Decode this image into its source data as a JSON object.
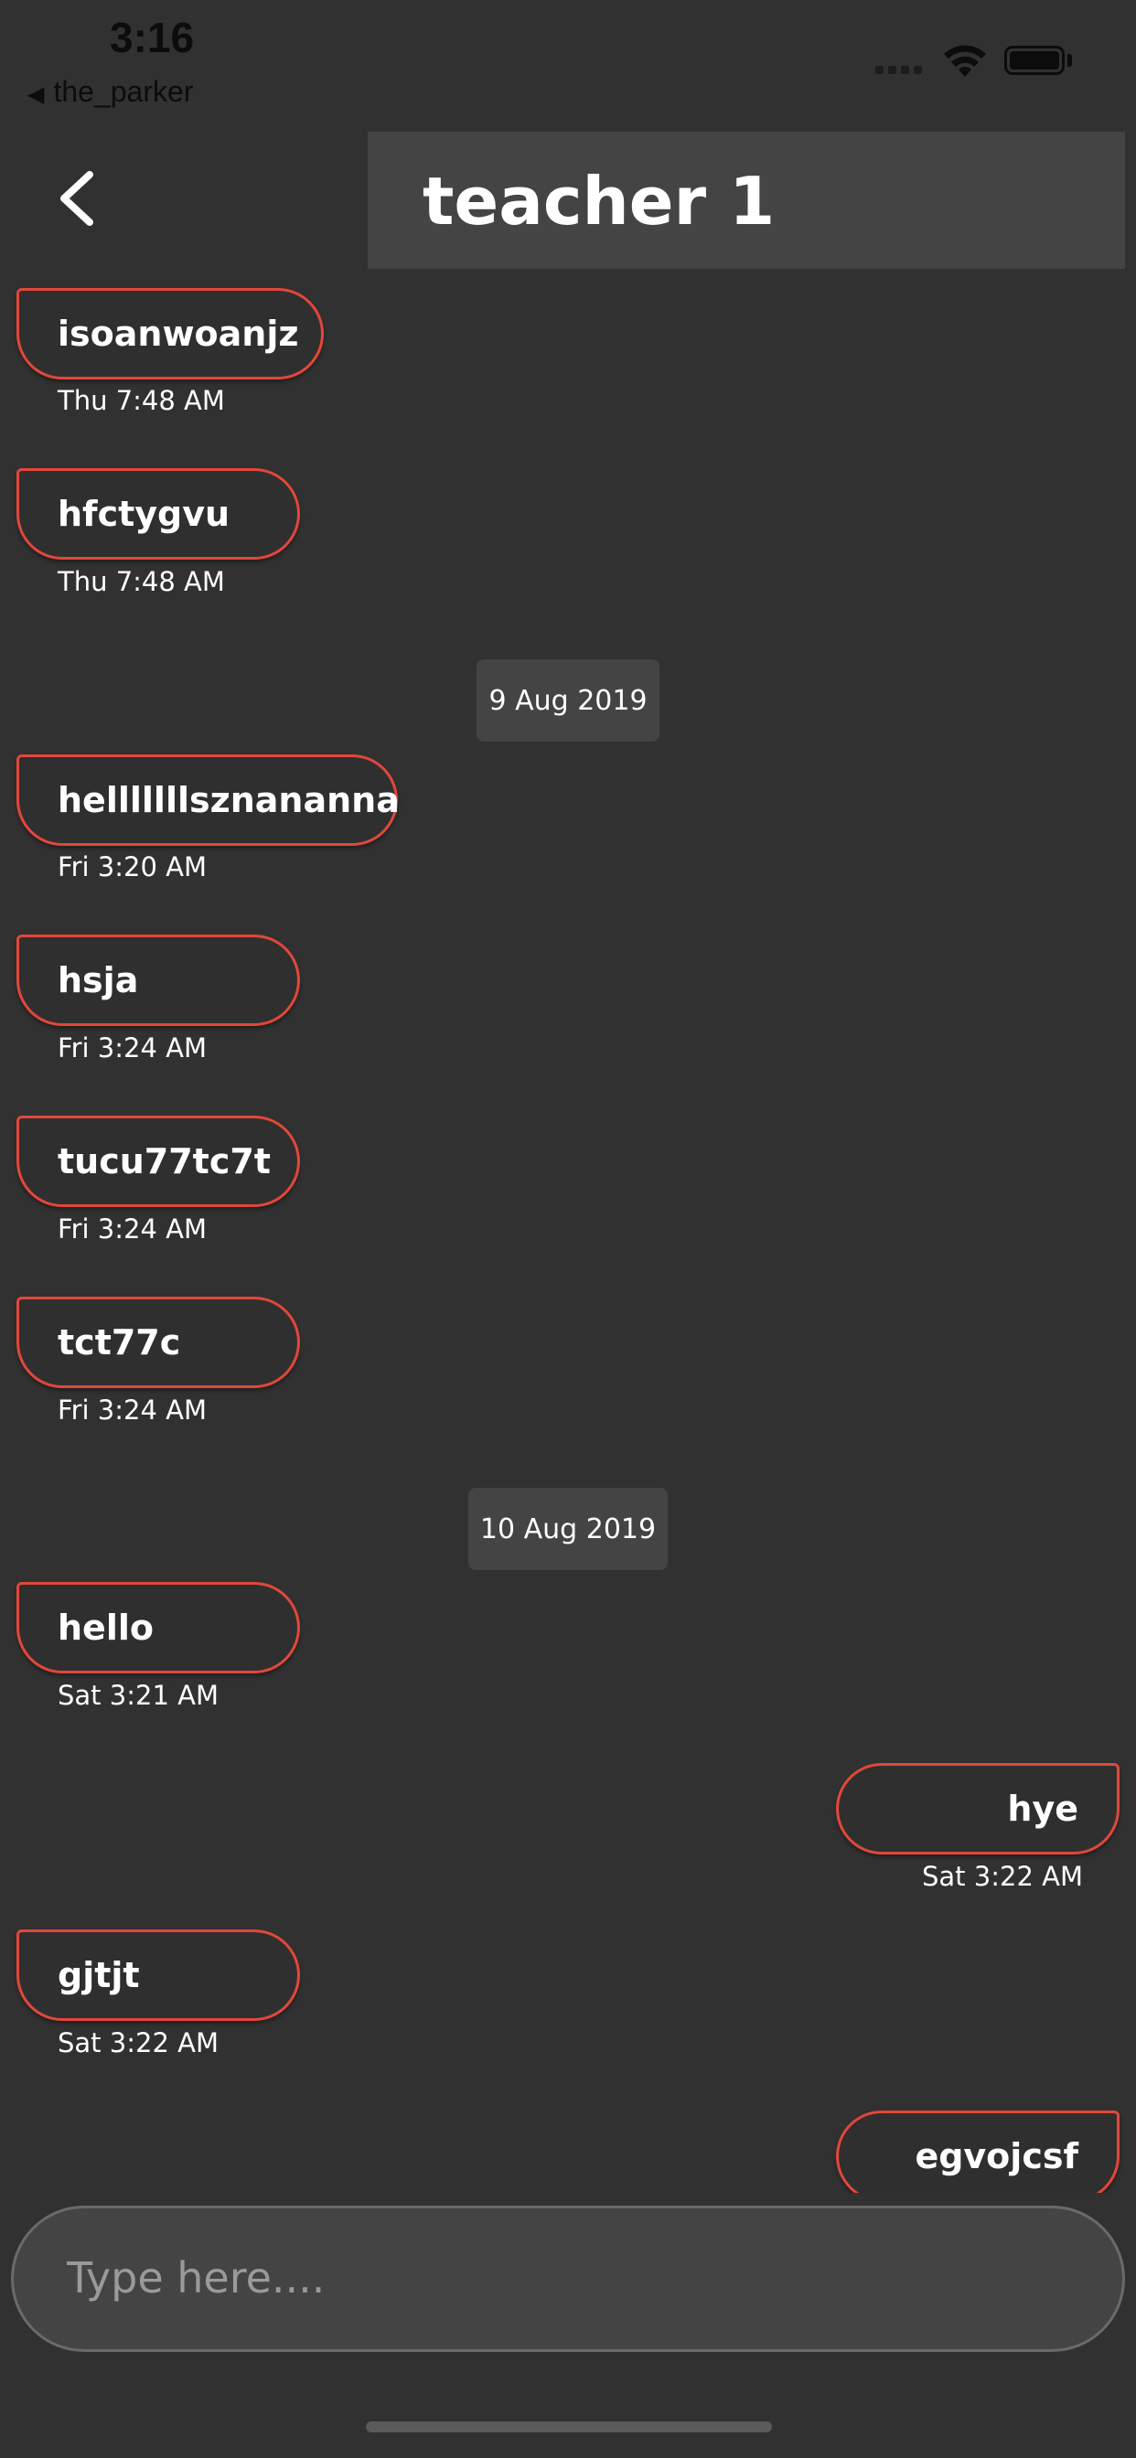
{
  "status_bar": {
    "time": "3:16",
    "back_app": "the_parker",
    "back_triangle": "◀"
  },
  "header": {
    "title": "teacher 1",
    "back_icon": "chevron-left-icon"
  },
  "dates": [
    "9 Aug 2019",
    "10 Aug 2019"
  ],
  "messages": [
    {
      "text": "isoanwoanjz",
      "time": "Thu 7:48 AM",
      "side": "in"
    },
    {
      "text": "hfctygvu",
      "time": "Thu 7:48 AM",
      "side": "in"
    },
    {
      "text": "helllllllsznananna",
      "time": "Fri 3:20 AM",
      "side": "in"
    },
    {
      "text": "hsja",
      "time": "Fri 3:24 AM",
      "side": "in"
    },
    {
      "text": "tucu77tc7t",
      "time": "Fri 3:24 AM",
      "side": "in"
    },
    {
      "text": "tct77c",
      "time": "Fri 3:24 AM",
      "side": "in"
    },
    {
      "text": "hello",
      "time": "Sat 3:21 AM",
      "side": "in"
    },
    {
      "text": "hye",
      "time": "Sat 3:22 AM",
      "side": "out"
    },
    {
      "text": "gjtjt",
      "time": "Sat 3:22 AM",
      "side": "in"
    },
    {
      "text": "egvojcsf",
      "time": "",
      "side": "out"
    }
  ],
  "composer": {
    "placeholder": "Type here...."
  },
  "colors": {
    "background": "#313131",
    "bubble_border": "#e2473b",
    "title_bar": "#444444"
  }
}
